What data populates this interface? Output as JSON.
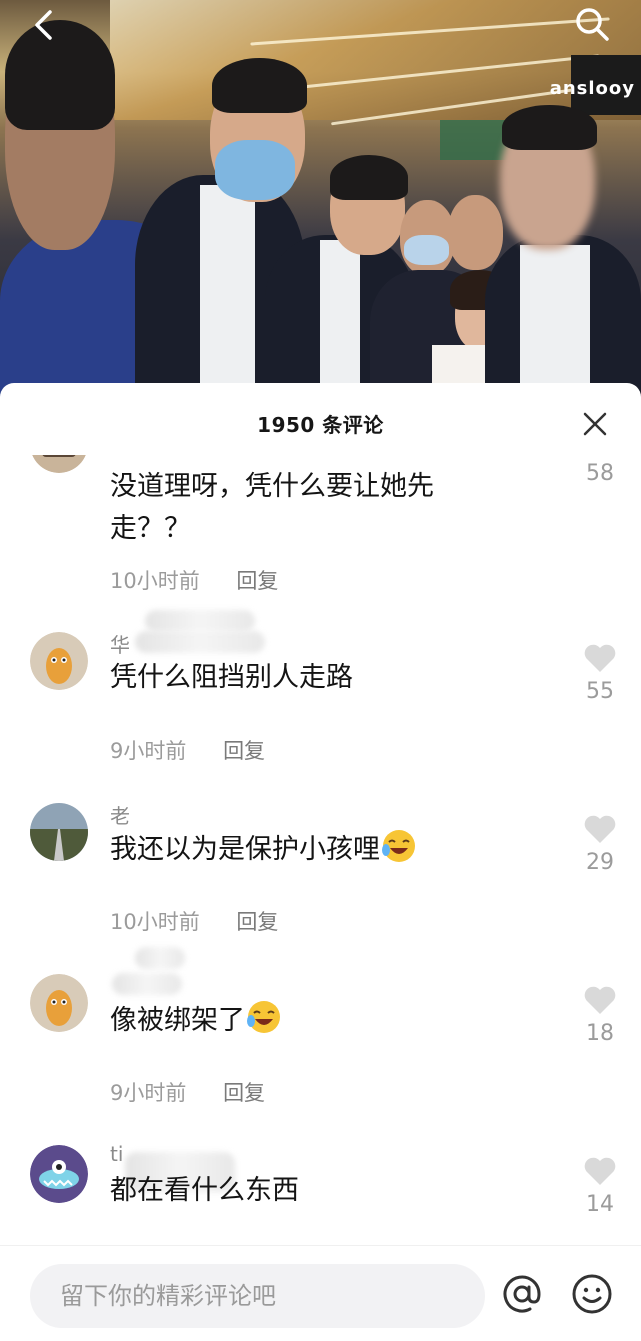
{
  "video": {
    "store_sign": "anslooy"
  },
  "comments_sheet": {
    "title": "1950 条评论"
  },
  "comments": [
    {
      "username": "",
      "text": "没道理呀，凭什么要让她先走？？",
      "time": "10小时前",
      "reply_label": "回复",
      "likes": "58",
      "avatar_icon": "cartoon-avatar-icon"
    },
    {
      "username": "华",
      "text": "凭什么阻挡别人走路",
      "time": "9小时前",
      "reply_label": "回复",
      "likes": "55",
      "avatar_icon": "peanut-avatar-icon"
    },
    {
      "username": "老",
      "text": "我还以为是保护小孩哩",
      "time": "10小时前",
      "reply_label": "回复",
      "likes": "29",
      "avatar_icon": "road-photo-avatar-icon",
      "emoji": "laughing-tears-emoji"
    },
    {
      "username": "",
      "text": "像被绑架了",
      "time": "9小时前",
      "reply_label": "回复",
      "likes": "18",
      "avatar_icon": "peanut-avatar-icon",
      "emoji": "laughing-tears-emoji"
    },
    {
      "username": "ti",
      "text": "都在看什么东西",
      "likes": "14",
      "avatar_icon": "monster-avatar-icon"
    }
  ],
  "input": {
    "placeholder": "留下你的精彩评论吧"
  },
  "colors": {
    "text_primary": "#141414",
    "text_secondary": "#9b9b9b",
    "like_icon": "#d9d9d9",
    "input_bg": "#f2f2f4"
  }
}
